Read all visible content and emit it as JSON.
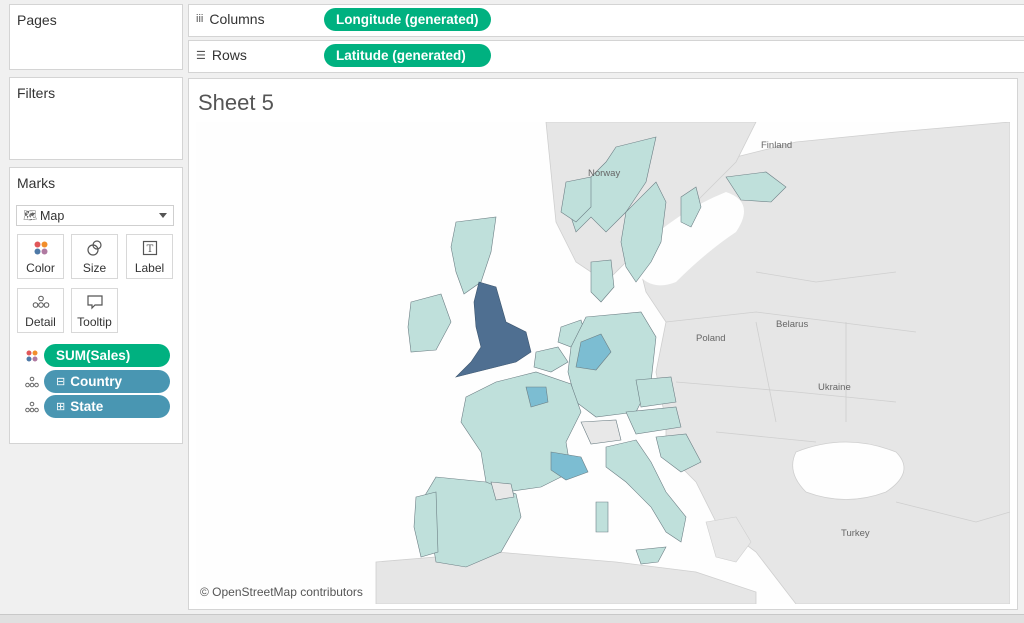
{
  "sidebar": {
    "pages_title": "Pages",
    "filters_title": "Filters",
    "marks_title": "Marks",
    "mark_type": "Map",
    "mark_buttons": [
      {
        "label": "Color",
        "icon": "color-icon"
      },
      {
        "label": "Size",
        "icon": "size-icon"
      },
      {
        "label": "Label",
        "icon": "label-icon"
      },
      {
        "label": "Detail",
        "icon": "detail-icon"
      },
      {
        "label": "Tooltip",
        "icon": "tooltip-icon"
      }
    ],
    "mark_fields": [
      {
        "label": "SUM(Sales)",
        "icon": "color-icon",
        "color": "#00b180"
      },
      {
        "label": "Country",
        "icon": "detail-icon",
        "color": "#4996b2"
      },
      {
        "label": "State",
        "icon": "detail-icon",
        "color": "#4996b2"
      }
    ]
  },
  "shelves": {
    "columns_label": "Columns",
    "columns_pill": "Longitude (generated)",
    "rows_label": "Rows",
    "rows_pill": "Latitude (generated)"
  },
  "sheet": {
    "title": "Sheet 5",
    "copyright": "© OpenStreetMap contributors",
    "country_labels": [
      "Finland",
      "Norway",
      "Poland",
      "Belarus",
      "Ukraine",
      "Turkey"
    ]
  },
  "colors": {
    "accent_green": "#00b180",
    "dimension_teal": "#4996b2",
    "map_background": "#e4e4e4",
    "region_light": "#bfe0db",
    "region_mid": "#7cbdd2",
    "region_dark": "#4f6f91"
  }
}
